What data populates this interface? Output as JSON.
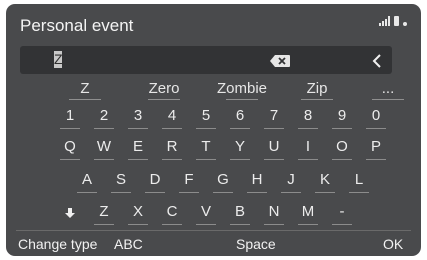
{
  "header": {
    "title": "Personal event"
  },
  "input": {
    "value": "Z"
  },
  "suggestions": [
    "Z",
    "Zero",
    "Zombie",
    "Zip",
    "..."
  ],
  "keyboard": {
    "row1": [
      "1",
      "2",
      "3",
      "4",
      "5",
      "6",
      "7",
      "8",
      "9",
      "0"
    ],
    "row2": [
      "Q",
      "W",
      "E",
      "R",
      "T",
      "Y",
      "U",
      "I",
      "O",
      "P"
    ],
    "row3": [
      "A",
      "S",
      "D",
      "F",
      "G",
      "H",
      "J",
      "K",
      "L"
    ],
    "row4": [
      "Z",
      "X",
      "C",
      "V",
      "B",
      "N",
      "M",
      "-"
    ]
  },
  "bottom": {
    "change_type": "Change type",
    "abc": "ABC",
    "space": "Space",
    "ok": "OK"
  },
  "icons": {
    "signal": "signal-bars-icon",
    "battery": "battery-icon",
    "backspace": "backspace-icon",
    "back": "chevron-left-icon",
    "shift": "shift-arrow-icon"
  },
  "colors": {
    "screen": "#494a4c",
    "field": "#323335",
    "text": "#ececec"
  }
}
